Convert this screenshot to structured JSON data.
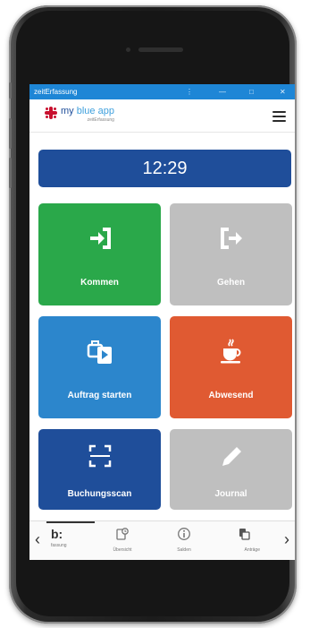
{
  "window": {
    "title": "zeitErfassung",
    "controls": [
      "⋮",
      "—",
      "□",
      "✕"
    ]
  },
  "header": {
    "logo_text_dark": "my",
    "logo_text_light": "blue app",
    "logo_sub": "zeitErfassung"
  },
  "clock": {
    "time": "12:29"
  },
  "tiles": [
    {
      "label": "Kommen",
      "color": "#2aa84a",
      "icon": "login-icon"
    },
    {
      "label": "Gehen",
      "color": "#bfbfbf",
      "icon": "logout-icon"
    },
    {
      "label": "Auftrag starten",
      "color": "#2c86cc",
      "icon": "briefcase-play-icon"
    },
    {
      "label": "Abwesend",
      "color": "#e05a32",
      "icon": "coffee-cup-icon"
    },
    {
      "label": "Buchungsscan",
      "color": "#1f4e9a",
      "icon": "scan-icon"
    },
    {
      "label": "Journal",
      "color": "#bfbfbf",
      "icon": "pencil-icon"
    }
  ],
  "navbar": {
    "items": [
      {
        "label": "fassung",
        "icon": "clock-grid-icon"
      },
      {
        "label": "Übersicht",
        "icon": "overview-icon"
      },
      {
        "label": "Salden",
        "icon": "info-icon"
      },
      {
        "label": "Anträge",
        "icon": "request-icon"
      }
    ]
  }
}
